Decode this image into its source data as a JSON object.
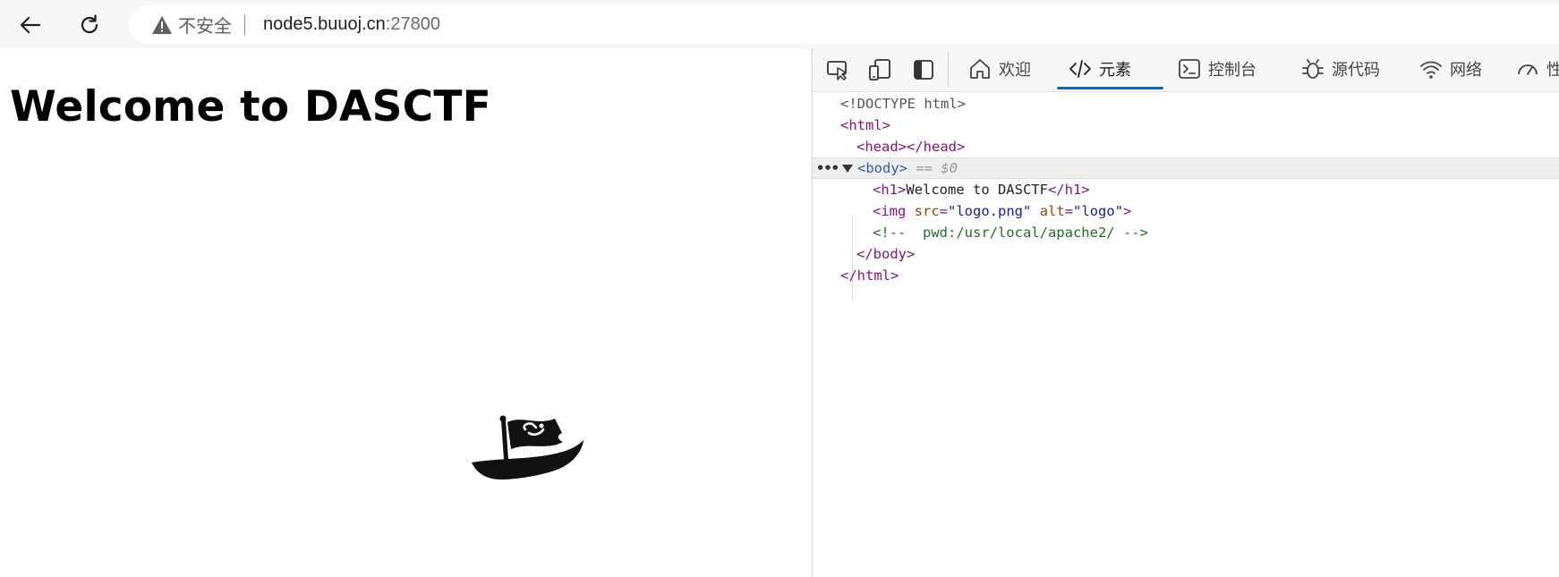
{
  "browser": {
    "security_label": "不安全",
    "url_host": "node5.buuoj.cn",
    "url_port": ":27800"
  },
  "page": {
    "heading": "Welcome to DASCTF",
    "logo_alt": "logo"
  },
  "devtools": {
    "tabs": [
      {
        "label": "欢迎",
        "icon": "home-icon"
      },
      {
        "label": "元素",
        "icon": "code-icon",
        "active": true
      },
      {
        "label": "控制台",
        "icon": "console-icon"
      },
      {
        "label": "源代码",
        "icon": "bug-icon"
      },
      {
        "label": "网络",
        "icon": "wifi-icon"
      },
      {
        "label": "性",
        "icon": "performance-icon"
      }
    ],
    "dom": {
      "doctype": "<!DOCTYPE html>",
      "html_open": "<html>",
      "head": "<head></head>",
      "body_open": "<body>",
      "selected_marker": "== $0",
      "h1_open": "<h1>",
      "h1_text": "Welcome to DASCTF",
      "h1_close": "</h1>",
      "img_tag": "<img",
      "img_src_name": "src",
      "img_src_value": "\"logo.png\"",
      "img_alt_name": "alt",
      "img_alt_value": "\"logo\"",
      "img_close": ">",
      "comment": "<!--  pwd:/usr/local/apache2/ -->",
      "body_close": "</body>",
      "html_close": "</html>"
    },
    "accent_color": "#0f6cbd"
  }
}
